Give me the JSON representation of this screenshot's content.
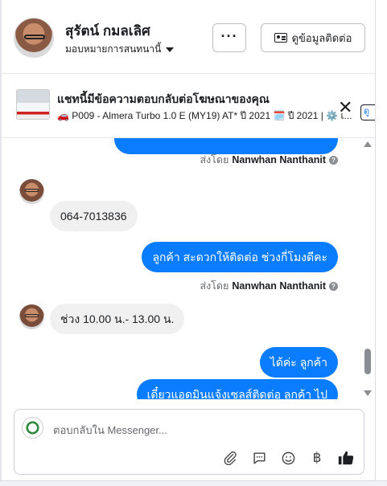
{
  "header": {
    "name": "สุรัตน์ กมลเลิศ",
    "assigned_label": "มอบหมายการสนทนานี้",
    "more_label": "···",
    "contact_info_label": "ดูข้อมูลติดต่อ"
  },
  "banner": {
    "title": "แชทนี้มีข้อความตอบกลับต่อโฆษณาของคุณ",
    "subtitle": "🚗 P009 - Almera Turbo 1.0 E (MY19) AT* ปี 2021 🗓️ ปี 2021 | ⚙️ เ...",
    "close_label": "✕",
    "view_label": "ดู"
  },
  "thread": {
    "messages": [
      {
        "direction": "out",
        "text": ""
      },
      {
        "direction": "meta",
        "sent_by_prefix": "ส่งโดย",
        "sender": "Nanwhan Nanthanit"
      },
      {
        "direction": "in",
        "text": "064-7013836"
      },
      {
        "direction": "out",
        "text": "ลูกค้า สะดวกให้ติดต่อ ช่วงกี่โมงดีคะ"
      },
      {
        "direction": "meta",
        "sent_by_prefix": "ส่งโดย",
        "sender": "Nanwhan Nanthanit"
      },
      {
        "direction": "in",
        "text": "ช่วง 10.00 น.- 13.00 น."
      },
      {
        "direction": "out",
        "text": "ได้ค่ะ  ลูกค้า"
      },
      {
        "direction": "out",
        "text": "เดี๋ยวแอดมินแจ้งเซลส์ติดต่อ ลูกค้า  ไป"
      }
    ]
  },
  "composer": {
    "placeholder": "ตอบกลับใน Messenger..."
  },
  "icons": {
    "attach": "paperclip-icon",
    "saved_reply": "chat-bubble-icon",
    "emoji": "smiley-icon",
    "payment": "baht-icon",
    "like": "thumbs-up-icon"
  },
  "colors": {
    "outgoing_bubble": "#0a7cff",
    "incoming_bubble": "#f0f0f0",
    "like_icon": "#1c1e21"
  }
}
